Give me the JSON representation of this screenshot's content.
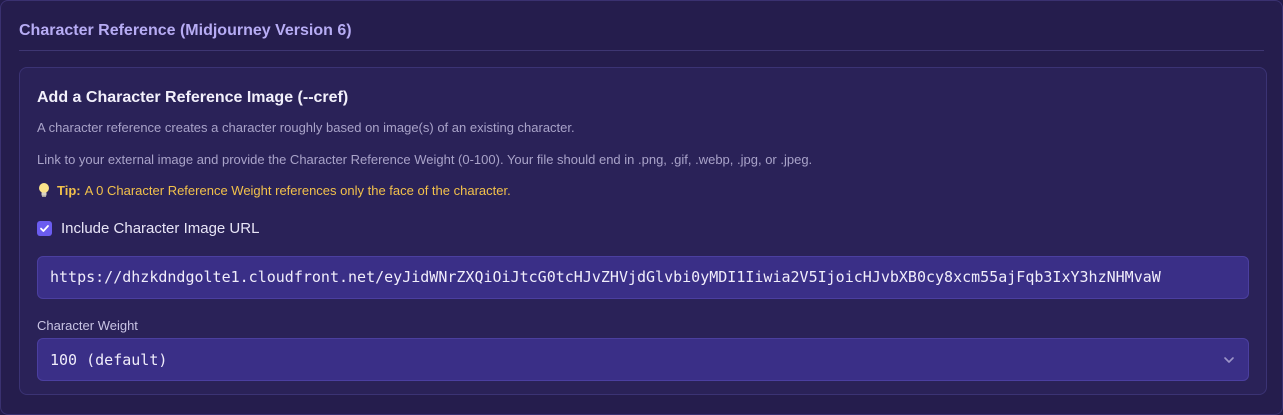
{
  "section": {
    "title": "Character Reference (Midjourney Version 6)"
  },
  "card": {
    "title": "Add a Character Reference Image (--cref)",
    "description_1": "A character reference creates a character roughly based on image(s) of an existing character.",
    "description_2": "Link to your external image and provide the Character Reference Weight (0-100). Your file should end in .png, .gif, .webp, .jpg, or .jpeg.",
    "tip": {
      "icon": "lightbulb-icon",
      "label": "Tip:",
      "text": "A 0 Character Reference Weight references only the face of the character."
    },
    "include_checkbox": {
      "checked": true,
      "label": "Include Character Image URL"
    },
    "url_input": {
      "value": "https://dhzkdndgolte1.cloudfront.net/eyJidWNrZXQiOiJtcG0tcHJvZHVjdGlvbi0yMDI1Iiwia2V5IjoicHJvbXB0cy8xcm55ajFqb3IxY3hzNHMvaW"
    },
    "weight": {
      "label": "Character Weight",
      "selected": "100 (default)"
    }
  },
  "colors": {
    "background": "#251d4d",
    "accent": "#6b5cf0",
    "tip": "#f2c14b",
    "title": "#b7acf4"
  }
}
